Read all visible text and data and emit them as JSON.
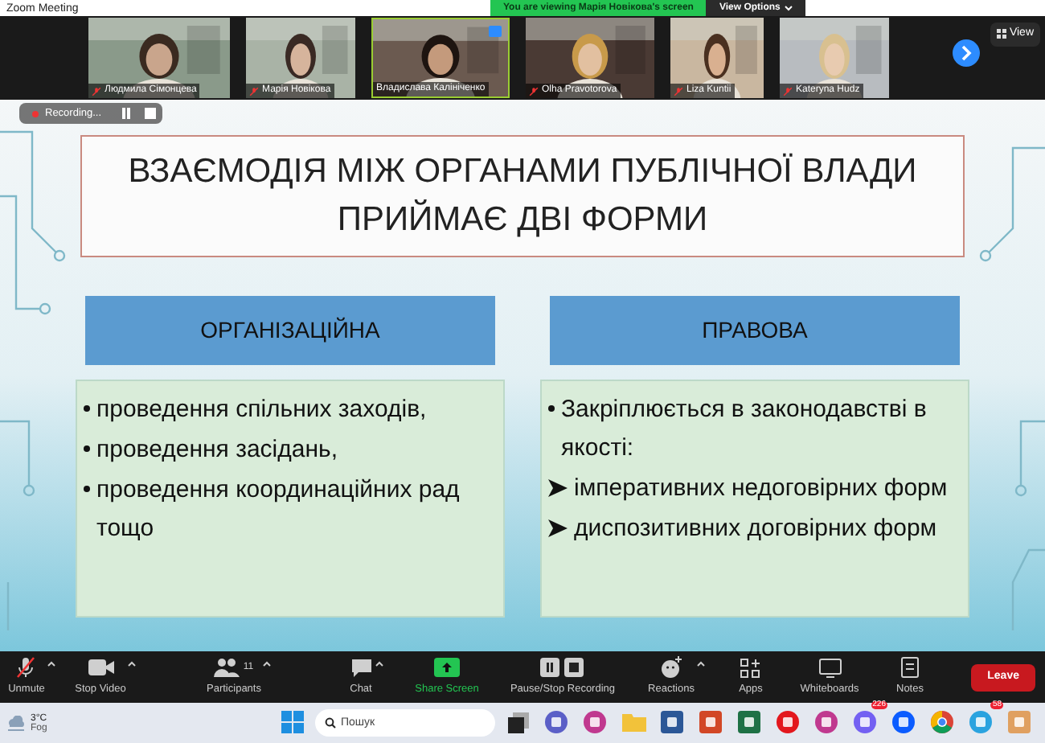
{
  "window": {
    "title": "Zoom Meeting"
  },
  "banner": {
    "text": "You are viewing Марія Новікова's screen",
    "button": "View Options"
  },
  "participants": [
    {
      "name": "Людмила Сімонцева",
      "muted": true,
      "speaking": false
    },
    {
      "name": "Марія Новікова",
      "muted": true,
      "speaking": false
    },
    {
      "name": "Владислава Калініченко",
      "muted": false,
      "speaking": true
    },
    {
      "name": "Olha Pravotorova",
      "muted": true,
      "speaking": false
    },
    {
      "name": "Liza Kuntii",
      "muted": true,
      "speaking": false
    },
    {
      "name": "Kateryna Hudz",
      "muted": true,
      "speaking": false
    }
  ],
  "view_button": "View",
  "recording": {
    "label": "Recording..."
  },
  "slide": {
    "title": "ВЗАЄМОДІЯ МІЖ ОРГАНАМИ ПУБЛІЧНОЇ ВЛАДИ ПРИЙМАЄ ДВІ ФОРМИ",
    "columns": [
      {
        "heading": "ОРГАНІЗАЦІЙНА",
        "items": [
          {
            "kind": "bullet",
            "text": "проведення спільних заходів,"
          },
          {
            "kind": "bullet",
            "text": "проведення засідань,"
          },
          {
            "kind": "bullet",
            "text": "проведення координаційних рад тощо"
          }
        ]
      },
      {
        "heading": "ПРАВОВА",
        "items": [
          {
            "kind": "bullet",
            "text": "Закріплюється в законодавстві в якості:"
          },
          {
            "kind": "arrow",
            "text": "імперативних недоговірних форм"
          },
          {
            "kind": "arrow",
            "text": "диспозитивних договірних форм"
          }
        ]
      }
    ]
  },
  "toolbar": [
    {
      "kind": "mic",
      "label": "Unmute",
      "menu": true
    },
    {
      "kind": "video",
      "label": "Stop Video",
      "menu": true
    },
    {
      "kind": "participants",
      "label": "Participants",
      "count": "11",
      "menu": true
    },
    {
      "kind": "chat",
      "label": "Chat",
      "menu": true
    },
    {
      "kind": "share",
      "label": "Share Screen",
      "menu": false
    },
    {
      "kind": "record",
      "label": "Pause/Stop Recording",
      "menu": false
    },
    {
      "kind": "reactions",
      "label": "Reactions",
      "menu": true
    },
    {
      "kind": "apps",
      "label": "Apps",
      "menu": false
    },
    {
      "kind": "whiteboard",
      "label": "Whiteboards",
      "menu": false
    },
    {
      "kind": "notes",
      "label": "Notes",
      "menu": false
    }
  ],
  "leave_button": "Leave",
  "taskbar": {
    "weather": {
      "temp": "3°C",
      "condition": "Fog"
    },
    "search": {
      "placeholder": "Пошук"
    },
    "apps": [
      {
        "kind": "start"
      },
      {
        "kind": "taskview"
      },
      {
        "kind": "meet"
      },
      {
        "kind": "wps"
      },
      {
        "kind": "folder"
      },
      {
        "kind": "word"
      },
      {
        "kind": "powerpoint"
      },
      {
        "kind": "excel"
      },
      {
        "kind": "opera"
      },
      {
        "kind": "wps"
      },
      {
        "kind": "viber",
        "badge": "226"
      },
      {
        "kind": "zoom"
      },
      {
        "kind": "chrome"
      },
      {
        "kind": "telegram",
        "badge": "58"
      },
      {
        "kind": "document"
      }
    ]
  }
}
